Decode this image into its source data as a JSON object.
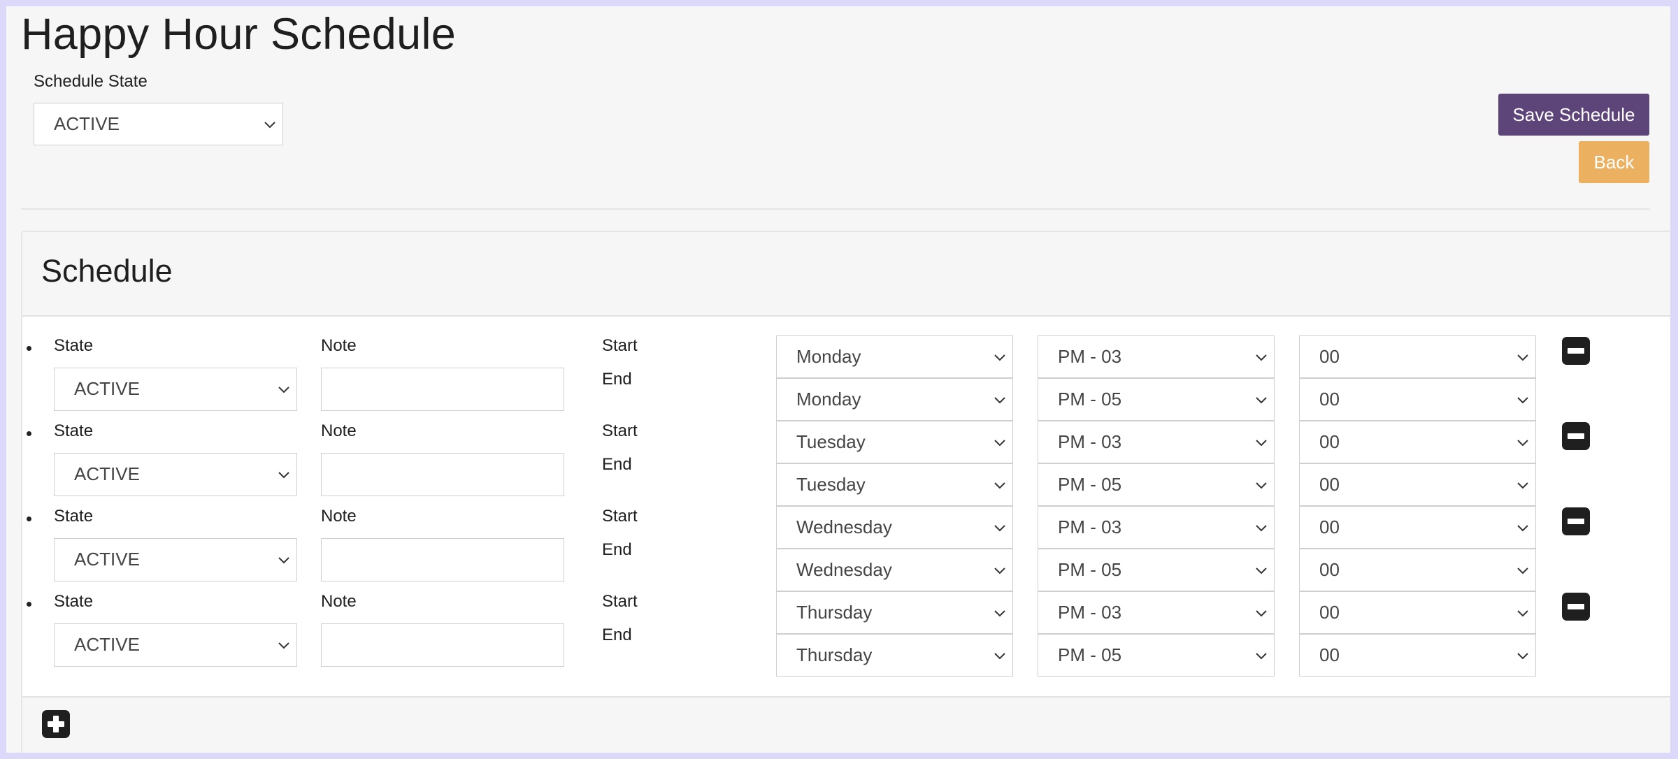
{
  "page": {
    "title": "Happy Hour Schedule"
  },
  "schedule_state": {
    "label": "Schedule State",
    "value": "ACTIVE"
  },
  "actions": {
    "save_label": "Save Schedule",
    "back_label": "Back"
  },
  "panel": {
    "title": "Schedule"
  },
  "field_labels": {
    "state": "State",
    "note": "Note",
    "start": "Start",
    "end": "End"
  },
  "rows": [
    {
      "state": "ACTIVE",
      "note": "",
      "start_day": "Monday",
      "start_hour": "PM - 03",
      "start_min": "00",
      "end_day": "Monday",
      "end_hour": "PM - 05",
      "end_min": "00"
    },
    {
      "state": "ACTIVE",
      "note": "",
      "start_day": "Tuesday",
      "start_hour": "PM - 03",
      "start_min": "00",
      "end_day": "Tuesday",
      "end_hour": "PM - 05",
      "end_min": "00"
    },
    {
      "state": "ACTIVE",
      "note": "",
      "start_day": "Wednesday",
      "start_hour": "PM - 03",
      "start_min": "00",
      "end_day": "Wednesday",
      "end_hour": "PM - 05",
      "end_min": "00"
    },
    {
      "state": "ACTIVE",
      "note": "",
      "start_day": "Thursday",
      "start_hour": "PM - 03",
      "start_min": "00",
      "end_day": "Thursday",
      "end_hour": "PM - 05",
      "end_min": "00"
    }
  ],
  "icons": {
    "remove": "minus-square-icon",
    "add": "plus-square-icon",
    "dropdown": "chevron-down-icon"
  },
  "colors": {
    "save": "#5e4579",
    "back": "#ebb160",
    "frame": "#dcd8fa"
  }
}
